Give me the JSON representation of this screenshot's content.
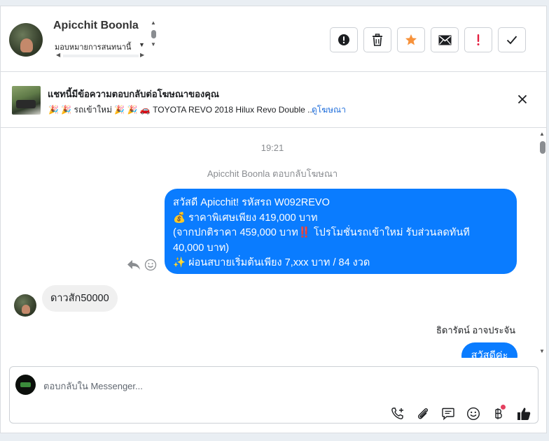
{
  "header": {
    "user_name": "Apicchit Boonla",
    "assign_label": "มอบหมายการสนทนานี้",
    "actions": [
      {
        "name": "mark-spam",
        "icon": "exclamation-circle-icon"
      },
      {
        "name": "delete",
        "icon": "trash-icon"
      },
      {
        "name": "star",
        "icon": "star-icon",
        "color": "#f7923b"
      },
      {
        "name": "mark-unread",
        "icon": "envelope-icon"
      },
      {
        "name": "follow-up",
        "icon": "exclamation-icon",
        "color": "#e41e3f"
      },
      {
        "name": "mark-done",
        "icon": "checkmark-icon"
      }
    ]
  },
  "ad_banner": {
    "title": "แชทนี้มีข้อความตอบกลับต่อโฆษณาของคุณ",
    "ad_text": "🎉 🎉 รถเข้าใหม่ 🎉 🎉  🚗  TOYOTA REVO 2018 Hilux Revo Double ...",
    "link_label": "ดูโฆษณา"
  },
  "conversation": {
    "timestamp": "19:21",
    "reply_note": "Apicchit Boonla ตอบกลับโฆษณา",
    "outgoing_message_lines": [
      "สวัสดี Apicchit! รหัสรถ W092REVO",
      "💰 ราคาพิเศษเพียง 419,000 บาท",
      "(จากปกติราคา  459,000 บาท‼️ โปรโมชั่นรถเข้าใหม่ รับส่วนลดทันที",
      "40,000 บาท)",
      "✨ ผ่อนสบายเริ่มต้นเพียง 7,xxx บาท / 84 งวด"
    ],
    "incoming_message": "ดาวสัก50000",
    "agent_name": "ธิดารัตน์ อาจประจัน",
    "outgoing_message_2": "สวัสดีค่ะ"
  },
  "composer": {
    "placeholder": "ตอบกลับใน Messenger...",
    "tools": [
      "add-contact-icon",
      "attachment-icon",
      "saved-replies-icon",
      "emoji-icon",
      "baht-payment-icon",
      "thumbs-up-icon"
    ]
  },
  "colors": {
    "accent": "#0a7cff",
    "link": "#216fdb",
    "star": "#f7923b",
    "alert": "#e41e3f"
  }
}
